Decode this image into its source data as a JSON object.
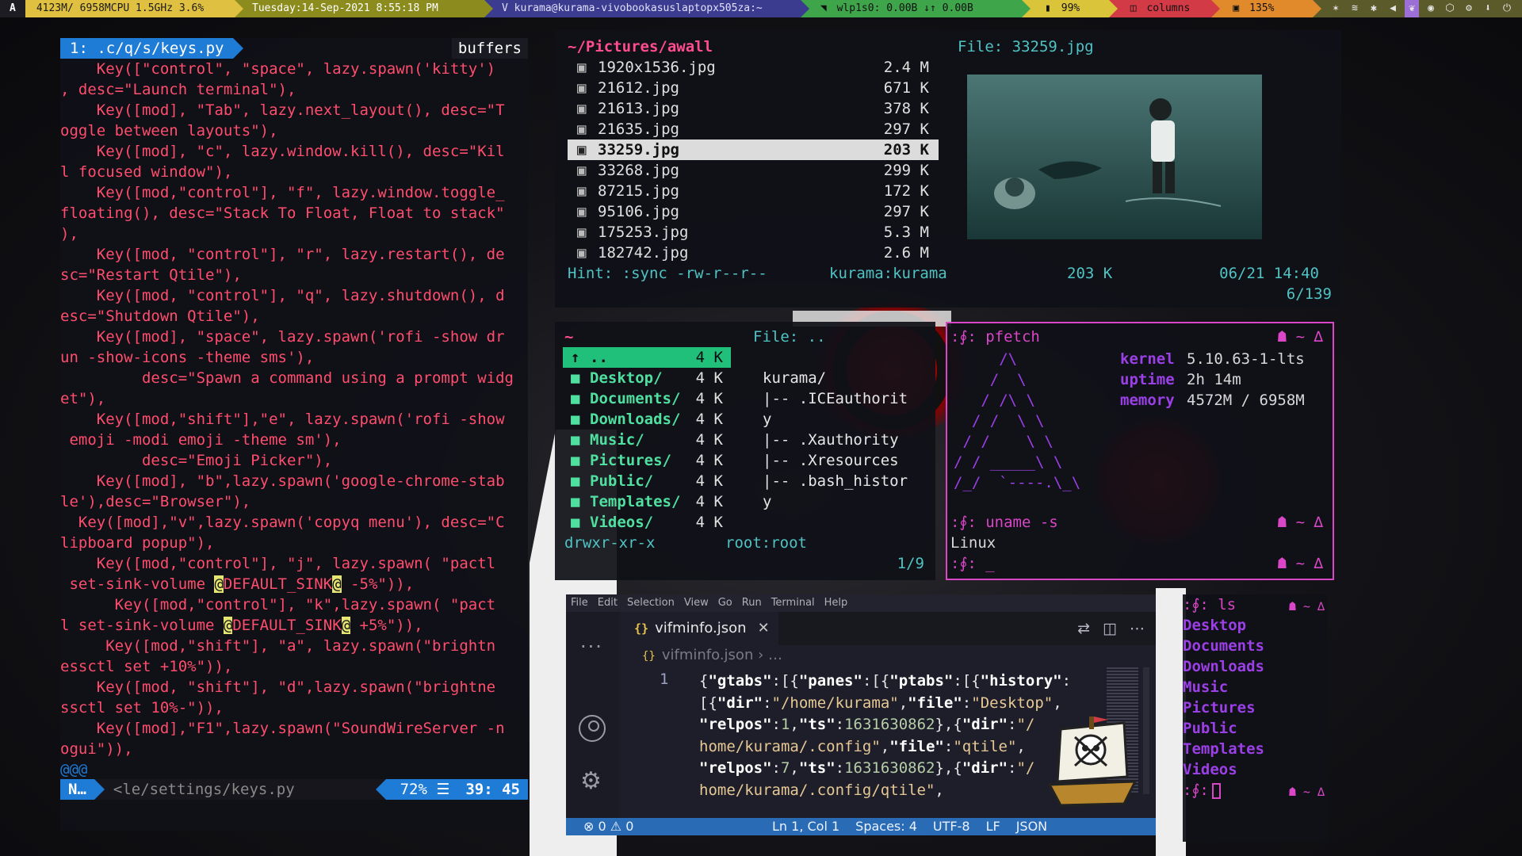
{
  "topbar": {
    "launcher": "A",
    "cpu_mem": "4123M/ 6958MCPU 1.5GHz 3.6%",
    "datetime": "Tuesday:14-Sep-2021  8:55:18 PM",
    "window_title": "V kurama@kurama-vivobookasuslaptopx505za:~",
    "network": "wlp1s0:  0.00B ↓↑  0.00B",
    "battery": "99%",
    "layout": "columns",
    "volume": "135%",
    "colors": {
      "yellow": "#e0c040",
      "olive": "#8b8b1e",
      "navy": "#3b3b8f",
      "green": "#3fa54a",
      "yellow2": "#d9c43a",
      "red": "#d23a45",
      "orange": "#e18a2c",
      "purple": "#7a4fc7"
    }
  },
  "vim": {
    "tab": "1: .c/q/s/keys.py",
    "buffers": "buffers",
    "lines": [
      "    Key([\"control\", \"space\", lazy.spawn('kitty')",
      ", desc=\"Launch terminal\"),",
      "    Key([mod], \"Tab\", lazy.next_layout(), desc=\"T",
      "oggle between layouts\"),",
      "    Key([mod], \"c\", lazy.window.kill(), desc=\"Kil",
      "l focused window\"),",
      "    Key([mod,\"control\"], \"f\", lazy.window.toggle_",
      "floating(), desc=\"Stack To Float, Float to stack\"",
      "),",
      "    Key([mod, \"control\"], \"r\", lazy.restart(), de",
      "sc=\"Restart Qtile\"),",
      "    Key([mod, \"control\"], \"q\", lazy.shutdown(), d",
      "esc=\"Shutdown Qtile\"),",
      "    Key([mod], \"space\", lazy.spawn('rofi -show dr",
      "un -show-icons -theme sms'),",
      "         desc=\"Spawn a command using a prompt widg",
      "et\"),",
      "    Key([mod,\"shift\"],\"e\", lazy.spawn('rofi -show",
      " emoji -modi emoji -theme sm'),",
      "         desc=\"Emoji Picker\"),",
      "    Key([mod], \"b\",lazy.spawn('google-chrome-stab",
      "le'),desc=\"Browser\"),",
      "  Key([mod],\"v\",lazy.spawn('copyq menu'), desc=\"C",
      "lipboard popup\"),",
      "    Key([mod,\"control\"], \"j\", lazy.spawn( \"pactl",
      " set-sink-volume @DEFAULT_SINK@ -5%\")),",
      "      Key([mod,\"control\"], \"k\",lazy.spawn( \"pact",
      "l set-sink-volume @DEFAULT_SINK@ +5%\")),",
      "     Key([mod,\"shift\"], \"a\", lazy.spawn(\"brightn",
      "essctl set +10%\")),",
      "    Key([mod, \"shift\"], \"d\",lazy.spawn(\"brightne",
      "ssctl set 10%-\")),",
      "    Key([mod],\"F1\",lazy.spawn(\"SoundWireServer -n",
      "ogui\")),"
    ],
    "tilde": "@@@",
    "status": {
      "mode": "N…",
      "file": "<le/settings/keys.py",
      "percent": "72% ☰",
      "position": "39: 45"
    }
  },
  "pictures": {
    "path": "~/Pictures/awall",
    "file_label": "File: 33259.jpg",
    "files": [
      {
        "name": "1920x1536.jpg",
        "size": "2.4 M"
      },
      {
        "name": "21612.jpg",
        "size": "671 K"
      },
      {
        "name": "21613.jpg",
        "size": "378 K"
      },
      {
        "name": "21635.jpg",
        "size": "297 K"
      },
      {
        "name": "33259.jpg",
        "size": "203 K",
        "selected": true
      },
      {
        "name": "33268.jpg",
        "size": "299 K"
      },
      {
        "name": "87215.jpg",
        "size": "172 K"
      },
      {
        "name": "95106.jpg",
        "size": "297 K"
      },
      {
        "name": "175253.jpg",
        "size": "5.3 M"
      },
      {
        "name": "182742.jpg",
        "size": "2.6 M"
      }
    ],
    "hint": "Hint: :sync -rw-r--r--",
    "owner": "kurama:kurama",
    "size": "203 K",
    "date": "06/21 14:40",
    "count": "6/139"
  },
  "home": {
    "path": "~",
    "file_label": "File: ..",
    "dirs": [
      {
        "name": "..",
        "size": "4 K",
        "selected": true
      },
      {
        "name": "Desktop/",
        "size": "4 K"
      },
      {
        "name": "Documents/",
        "size": "4 K"
      },
      {
        "name": "Downloads/",
        "size": "4 K"
      },
      {
        "name": "Music/",
        "size": "4 K"
      },
      {
        "name": "Pictures/",
        "size": "4 K"
      },
      {
        "name": "Public/",
        "size": "4 K"
      },
      {
        "name": "Templates/",
        "size": "4 K"
      },
      {
        "name": "Videos/",
        "size": "4 K"
      }
    ],
    "preview": [
      "kurama/",
      "|-- .ICEauthorit",
      "y",
      "|-- .Xauthority",
      "|-- .Xresources",
      "|-- .bash_histor",
      "y"
    ],
    "permissions": "drwxr-xr-x",
    "owner": "root:root",
    "count": "1/9"
  },
  "pfetch": {
    "prompt1": ":∮: pfetch",
    "right": "☗ ~ ∆",
    "art": [
      "     /\\",
      "    /  \\",
      "   / /\\ \\",
      "  / /  \\ \\",
      " / /    \\ \\",
      "/ / _____\\ \\",
      "/_/  `----.\\_\\"
    ],
    "info": [
      {
        "key": "kernel",
        "value": "5.10.63-1-lts"
      },
      {
        "key": "uptime",
        "value": "2h 14m"
      },
      {
        "key": "memory",
        "value": "4572M / 6958M"
      }
    ],
    "prompt2": ":∮: uname -s",
    "output2": "Linux",
    "prompt3": ":∮: _"
  },
  "lsterm": {
    "prompt1": ":∮: ls",
    "right": "☗ ~ ∆",
    "items": [
      "Desktop",
      "Documents",
      "Downloads",
      "Music",
      "Pictures",
      "Public",
      "Templates",
      "Videos"
    ],
    "prompt2": ":∮:"
  },
  "vscode": {
    "menu": [
      "File",
      "Edit",
      "Selection",
      "View",
      "Go",
      "Run",
      "Terminal",
      "Help"
    ],
    "tab_icon": "{}",
    "tab_name": "vifminfo.json",
    "breadcrumb": "vifminfo.json",
    "breadcrumb_more": "› …",
    "line_number": "1",
    "status": {
      "problems": "⊗ 0 ⚠ 0",
      "position": "Ln 1, Col 1",
      "spaces": "Spaces: 4",
      "encoding": "UTF-8",
      "eol": "LF",
      "lang": "JSON"
    }
  }
}
